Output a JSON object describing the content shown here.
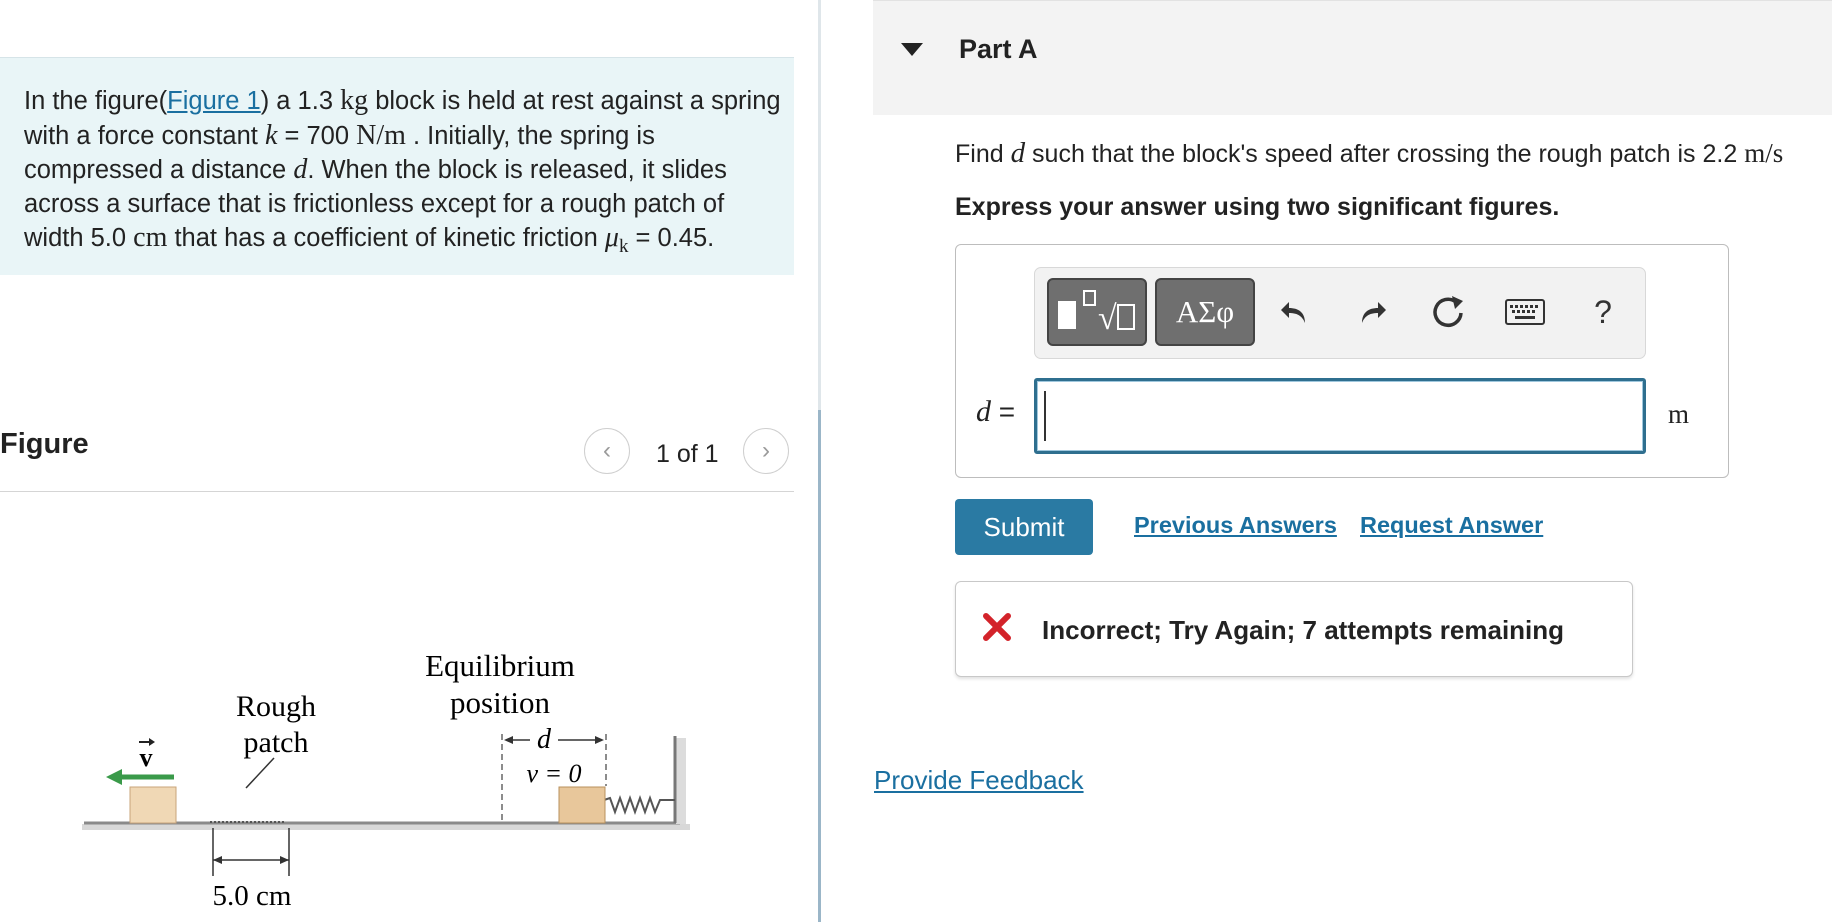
{
  "problem": {
    "t1": "In the figure(",
    "figure_link": "Figure 1",
    "t2": ") a 1.3 ",
    "mass_unit": "kg",
    "t3": " block is held at rest against a spring with a force constant ",
    "k_sym": "k",
    "t4": " = 700 ",
    "k_unit": "N/m",
    "t5": " . Initially, the spring is compressed a distance ",
    "d_sym": "d",
    "t6": ". When the block is released, it slides across a surface that is frictionless except for a rough patch of width 5.0 ",
    "cm_unit": "cm",
    "t7": " that has a coefficient of kinetic friction ",
    "mu_sym": "μ",
    "mu_sub": "k",
    "t8": " = 0.45."
  },
  "figure_panel": {
    "title": "Figure",
    "pager": "1 of 1",
    "prev_glyph": "‹",
    "next_glyph": "›"
  },
  "figure": {
    "equilibrium_line1": "Equilibrium",
    "equilibrium_line2": "position",
    "rough_line1": "Rough",
    "rough_line2": "patch",
    "d_label": "d",
    "v_label": "v = 0",
    "vec_label": "v",
    "width_label": "5.0 cm",
    "block_color": "#e8c79b"
  },
  "part": {
    "title": "Part A",
    "question_t1": "Find ",
    "question_d": "d",
    "question_t2": " such that the block's speed after crossing the rough patch is 2.2 ",
    "question_unit": "m/s",
    "instruction": "Express your answer using two significant figures."
  },
  "toolbar": {
    "greek_label": "ΑΣφ",
    "help_label": "?",
    "icons": [
      "template-icon",
      "greek-icon",
      "undo-icon",
      "redo-icon",
      "reset-icon",
      "keyboard-icon",
      "help-icon"
    ]
  },
  "answer": {
    "label_var": "d",
    "label_eq": " =",
    "value": "",
    "unit": "m"
  },
  "actions": {
    "submit": "Submit",
    "previous_answers": "Previous Answers",
    "request_answer": "Request Answer"
  },
  "feedback": {
    "message": "Incorrect; Try Again; 7 attempts remaining",
    "error_color": "#d3232a"
  },
  "footer": {
    "provide_feedback": "Provide Feedback"
  },
  "colors": {
    "accent": "#2a7aa3",
    "problem_bg": "#e9f5f7",
    "arrow_green": "#3a9a4a"
  }
}
